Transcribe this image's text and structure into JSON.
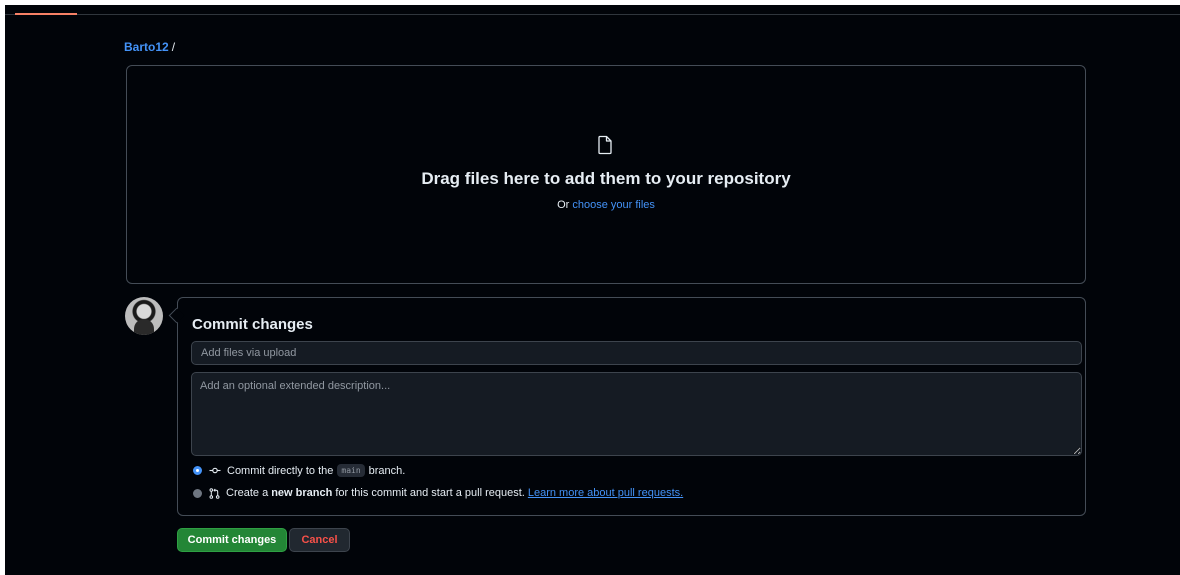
{
  "breadcrumb": {
    "owner": "Barto12",
    "separator": "/"
  },
  "upload": {
    "title": "Drag files here to add them to your repository",
    "prefix": "Or",
    "choose_link": "choose your files"
  },
  "commit": {
    "title": "Commit changes",
    "summary_placeholder": "Add files via upload",
    "description_placeholder": "Add an optional extended description...",
    "option_direct": {
      "prefix": "Commit directly to the",
      "branch": "main",
      "suffix": "branch.",
      "selected": true
    },
    "option_new_branch": {
      "prefix": "Create a",
      "bold": "new branch",
      "suffix": "for this commit and start a pull request.",
      "link": "Learn more about pull requests.",
      "selected": false
    },
    "commit_button": "Commit changes",
    "cancel_button": "Cancel"
  },
  "colors": {
    "background": "#010409",
    "border": "#444c56",
    "link": "#4493f8",
    "primary_button": "#238636",
    "danger_text": "#f85149"
  },
  "icons": {
    "file": "file-icon",
    "commit": "git-commit-icon",
    "pull_request": "git-pull-request-icon"
  }
}
